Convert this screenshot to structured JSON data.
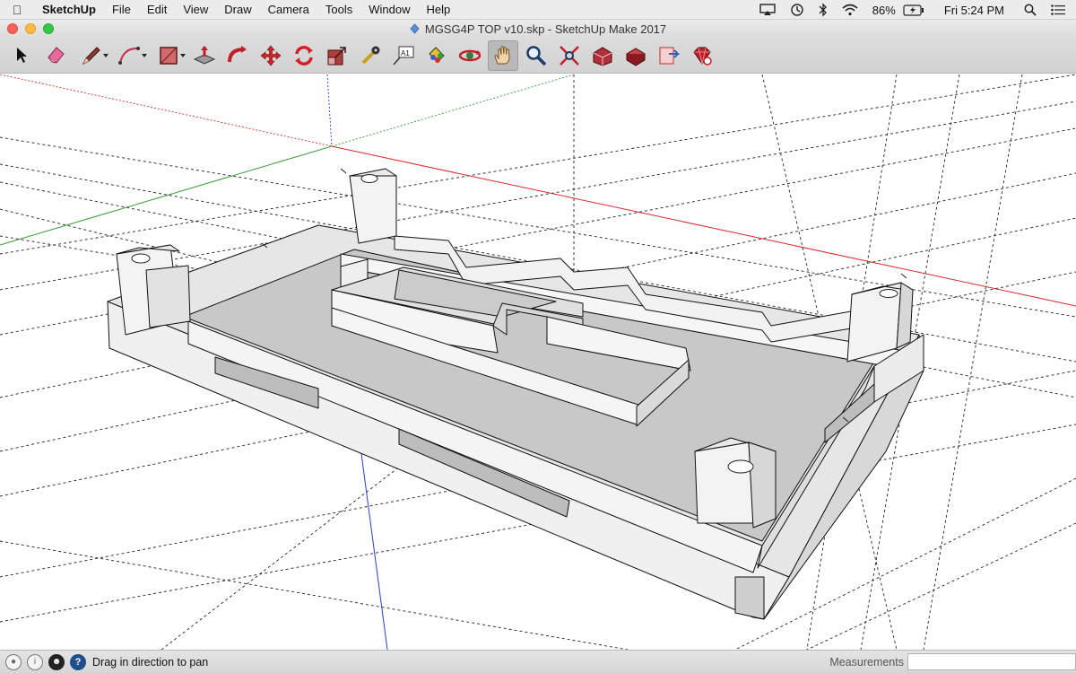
{
  "menubar": {
    "apple": "",
    "items": [
      "SketchUp",
      "File",
      "Edit",
      "View",
      "Draw",
      "Camera",
      "Tools",
      "Window",
      "Help"
    ],
    "battery": "86%",
    "clock": "Fri 5:24 PM"
  },
  "window": {
    "title": "MGSG4P TOP v10.skp - SketchUp Make 2017"
  },
  "toolbar": {
    "tools": [
      "select-tool",
      "eraser-tool",
      "line-tool",
      "arc-tool",
      "rectangle-tool",
      "push-pull-tool",
      "follow-me-tool",
      "move-tool",
      "rotate-tool",
      "scale-tool",
      "tape-measure-tool",
      "text-tool",
      "paint-bucket-tool",
      "orbit-tool",
      "pan-tool",
      "zoom-tool",
      "zoom-extents-tool",
      "3d-warehouse-tool",
      "extension-warehouse-tool",
      "layout-tool",
      "extension-manager-tool"
    ],
    "active": "pan-tool",
    "text_tool_label": "A1"
  },
  "statusbar": {
    "hint": "Drag in direction to pan",
    "measurements_label": "Measurements",
    "measurements_value": ""
  },
  "colors": {
    "axis_red": "#d42a2a",
    "axis_green": "#3a9a3a",
    "axis_blue": "#2a3fc8",
    "model_top": "#f2f2f2",
    "model_side": "#d2d2d2",
    "model_floor": "#c4c4c4"
  }
}
